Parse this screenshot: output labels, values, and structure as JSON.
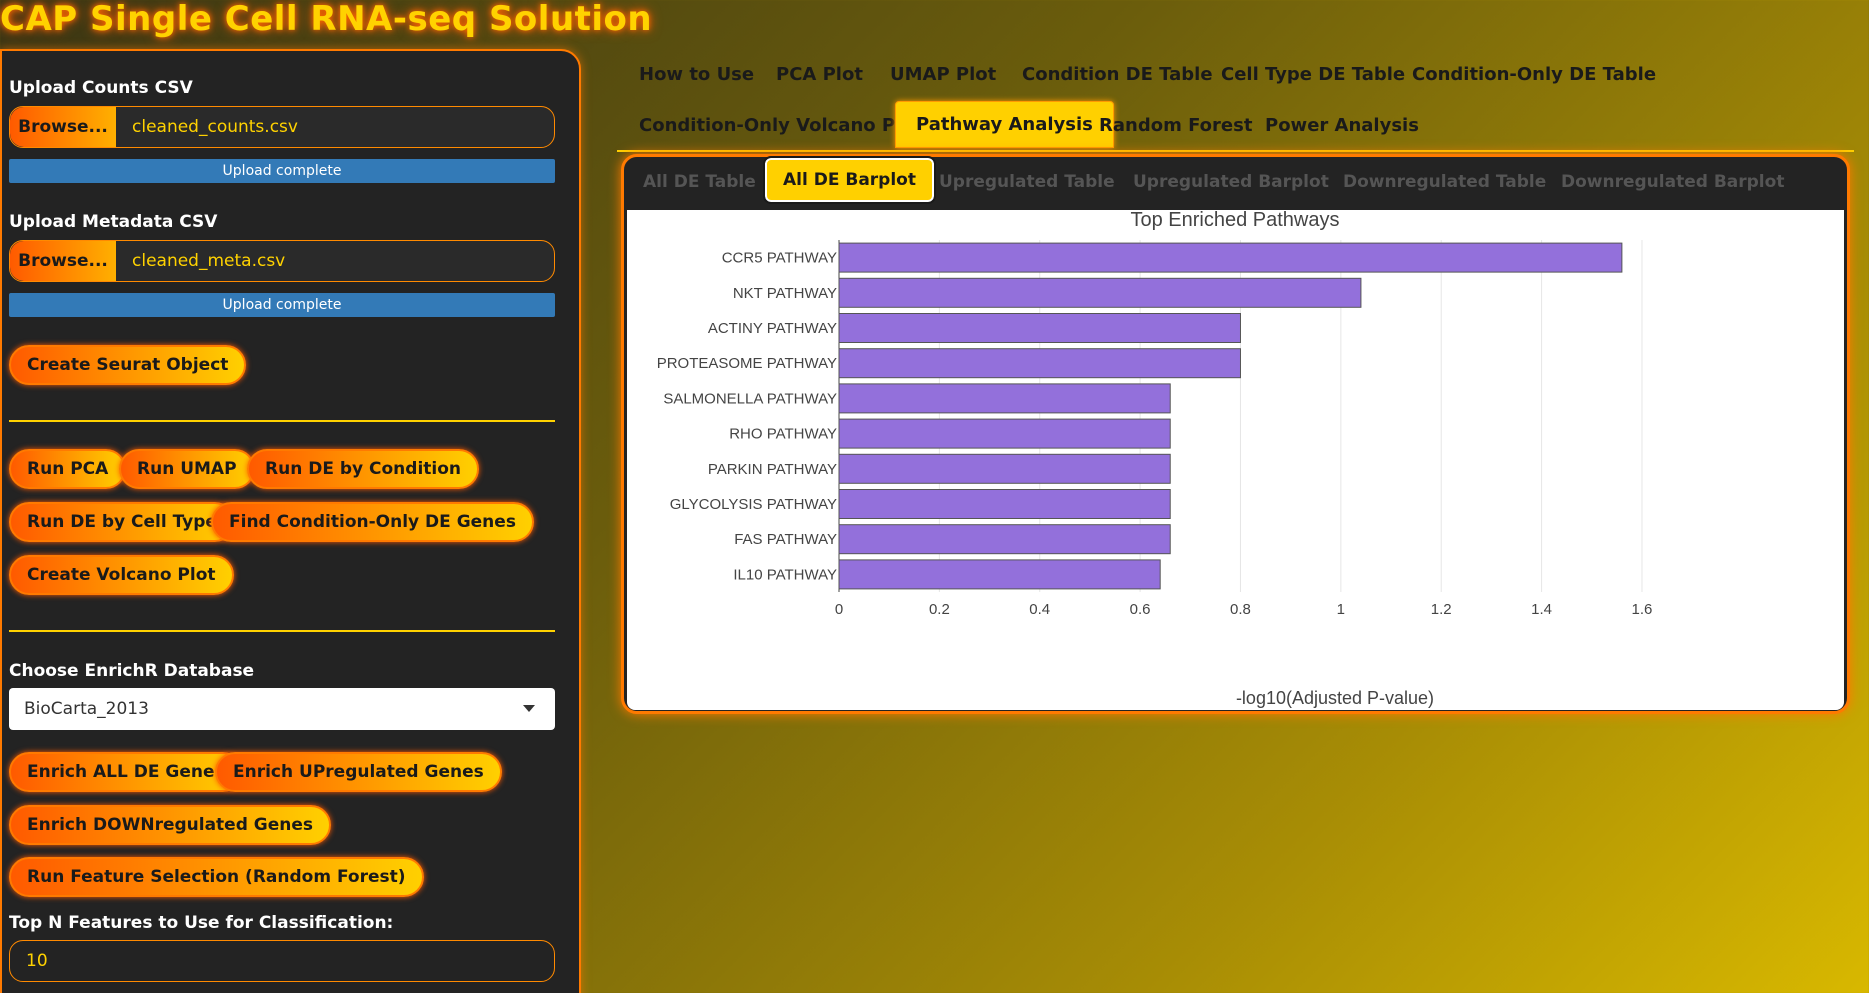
{
  "app": {
    "title": "CAP Single Cell RNA-seq Solution"
  },
  "sidebar": {
    "counts_label": "Upload Counts CSV",
    "counts_browse": "Browse...",
    "counts_file": "cleaned_counts.csv",
    "counts_status": "Upload complete",
    "meta_label": "Upload Metadata CSV",
    "meta_browse": "Browse...",
    "meta_file": "cleaned_meta.csv",
    "meta_status": "Upload complete",
    "create_seurat": "Create Seurat Object",
    "run_pca": "Run PCA",
    "run_umap": "Run UMAP",
    "run_de_condition": "Run DE by Condition",
    "run_de_celltype": "Run DE by Cell Type",
    "find_condition_only": "Find Condition-Only DE Genes",
    "create_volcano": "Create Volcano Plot",
    "enrichr_label": "Choose EnrichR Database",
    "enrichr_value": "BioCarta_2013",
    "enrich_all": "Enrich ALL DE Genes",
    "enrich_up": "Enrich UPregulated Genes",
    "enrich_down": "Enrich DOWNregulated Genes",
    "run_rf": "Run Feature Selection (Random Forest)",
    "topn_label": "Top N Features to Use for Classification:",
    "topn_value": "10"
  },
  "tabs": {
    "how_to_use": "How to Use",
    "pca": "PCA Plot",
    "umap": "UMAP Plot",
    "condition_de": "Condition DE Table",
    "celltype_de": "Cell Type DE Table",
    "condition_only_de": "Condition-Only DE Table",
    "condition_only_volcano": "Condition-Only Volcano Plot",
    "pathway": "Pathway Analysis",
    "random_forest": "Random Forest",
    "power": "Power Analysis"
  },
  "subtabs": {
    "all_de_table": "All DE Table",
    "all_de_barplot": "All DE Barplot",
    "up_table": "Upregulated Table",
    "up_barplot": "Upregulated Barplot",
    "down_table": "Downregulated Table",
    "down_barplot": "Downregulated Barplot"
  },
  "chart_data": {
    "type": "bar",
    "orientation": "horizontal",
    "title": "Top Enriched Pathways",
    "xlabel": "-log10(Adjusted P-value)",
    "ylabel": "",
    "xlim": [
      0,
      1.62
    ],
    "xticks": [
      0,
      0.2,
      0.4,
      0.6,
      0.8,
      1,
      1.2,
      1.4,
      1.6
    ],
    "grid": true,
    "bar_color": "#9370db",
    "categories": [
      "CCR5 PATHWAY",
      "NKT PATHWAY",
      "ACTINY PATHWAY",
      "PROTEASOME PATHWAY",
      "SALMONELLA PATHWAY",
      "RHO PATHWAY",
      "PARKIN PATHWAY",
      "GLYCOLYSIS PATHWAY",
      "FAS PATHWAY",
      "IL10 PATHWAY"
    ],
    "values": [
      1.56,
      1.04,
      0.8,
      0.8,
      0.66,
      0.66,
      0.66,
      0.66,
      0.66,
      0.64
    ]
  }
}
